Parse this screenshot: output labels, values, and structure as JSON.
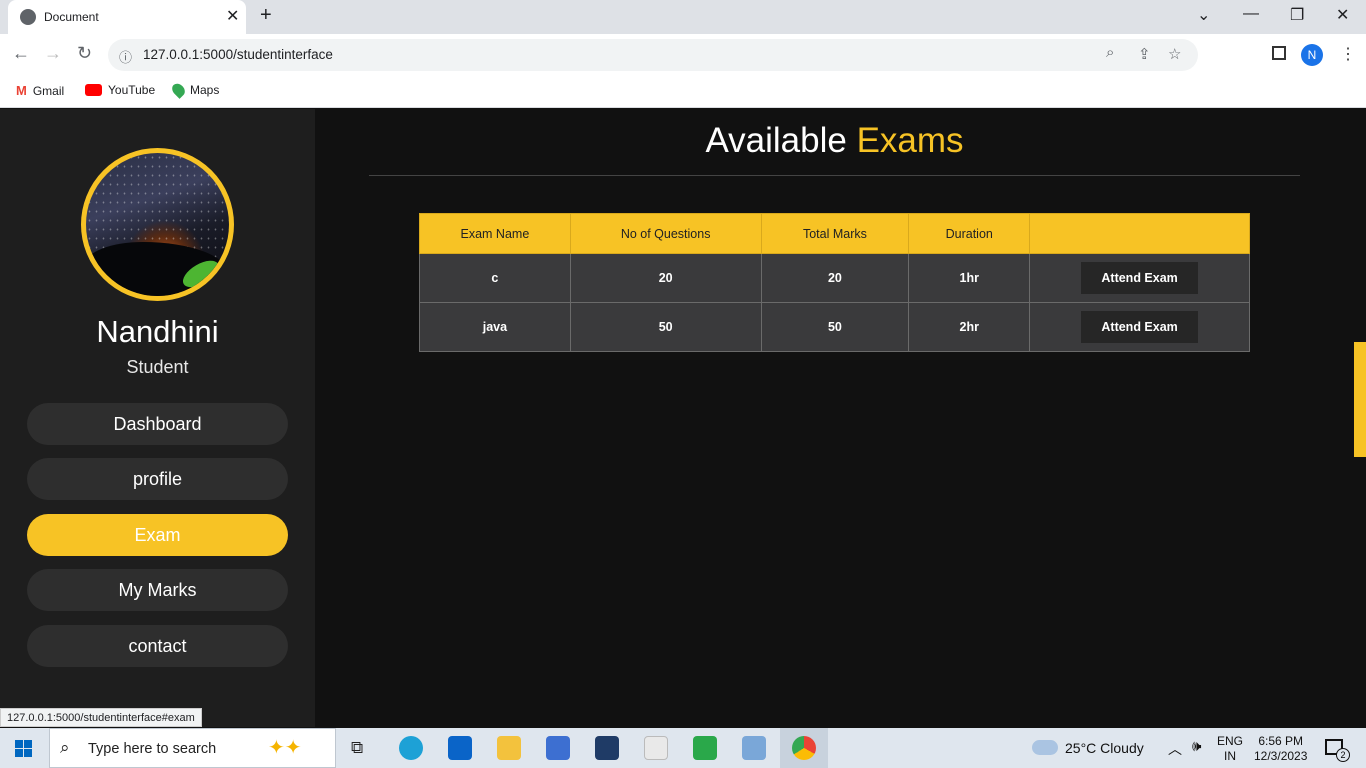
{
  "browser": {
    "tab_title": "Document",
    "url": "127.0.0.1:5000/studentinterface",
    "bookmarks": [
      "Gmail",
      "YouTube",
      "Maps"
    ],
    "profile_initial": "N",
    "status_url": "127.0.0.1:5000/studentinterface#exam"
  },
  "sidebar": {
    "name": "Nandhini",
    "role": "Student",
    "nav": [
      {
        "label": "Dashboard",
        "active": false
      },
      {
        "label": "profile",
        "active": false
      },
      {
        "label": "Exam",
        "active": true
      },
      {
        "label": "My Marks",
        "active": false
      },
      {
        "label": "contact",
        "active": false
      }
    ]
  },
  "main": {
    "title_part1": "Available",
    "title_part2": "Exams",
    "table": {
      "headers": [
        "Exam Name",
        "No of Questions",
        "Total Marks",
        "Duration",
        ""
      ],
      "rows": [
        {
          "name": "c",
          "questions": "20",
          "marks": "20",
          "duration": "1hr",
          "action": "Attend Exam"
        },
        {
          "name": "java",
          "questions": "50",
          "marks": "50",
          "duration": "2hr",
          "action": "Attend Exam"
        }
      ]
    }
  },
  "taskbar": {
    "search_placeholder": "Type here to search",
    "weather": "25°C  Cloudy",
    "lang": "ENG",
    "region": "IN",
    "time": "6:56 PM",
    "date": "12/3/2023",
    "notifications": "2"
  },
  "colors": {
    "accent": "#f7c325",
    "sidebar": "#1e1e1e",
    "page": "#111111"
  }
}
